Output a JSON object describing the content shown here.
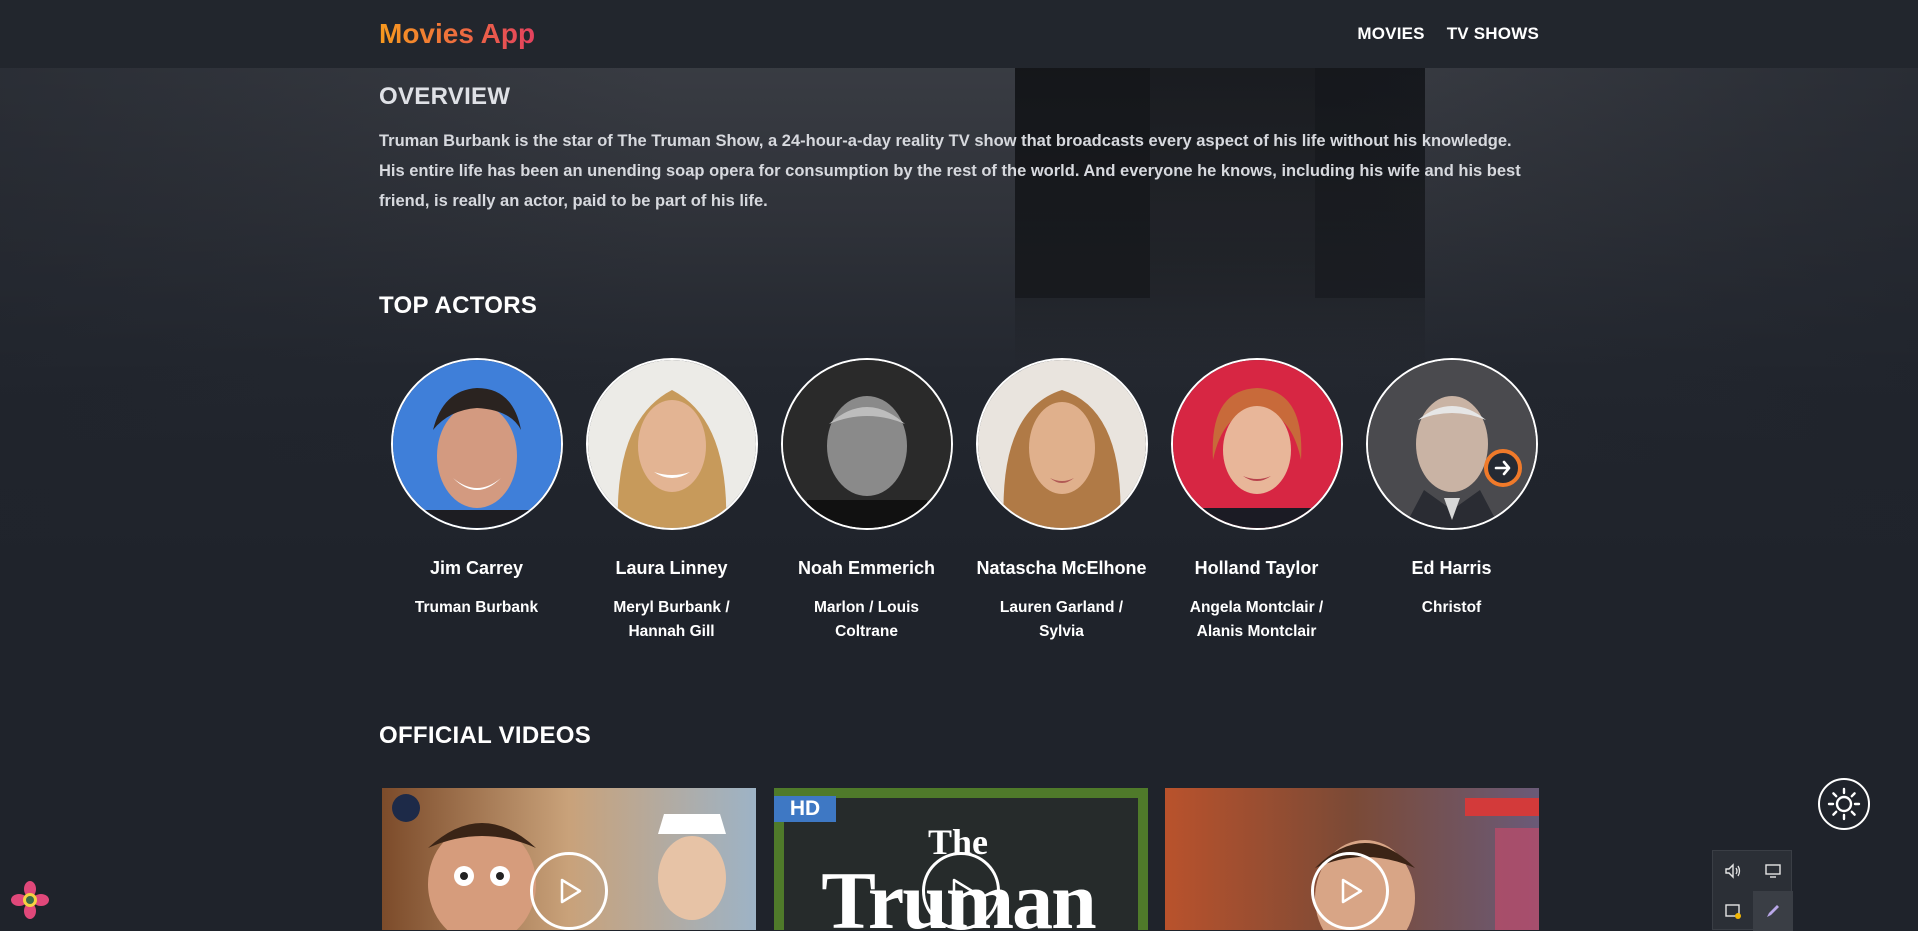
{
  "app": {
    "title": "Movies App"
  },
  "nav": {
    "movies": "MOVIES",
    "tv_shows": "TV SHOWS"
  },
  "overview": {
    "title": "OVERVIEW",
    "text": "Truman Burbank is the star of The Truman Show, a 24-hour-a-day reality TV show that broadcasts every aspect of his life without his knowledge. His entire life has been an unending soap opera for consumption by the rest of the world. And everyone he knows, including his wife and his best friend, is really an actor, paid to be part of his life."
  },
  "actors": {
    "title": "TOP ACTORS",
    "list": [
      {
        "name": "Jim Carrey",
        "role": "Truman Burbank"
      },
      {
        "name": "Laura Linney",
        "role": "Meryl Burbank / Hannah Gill"
      },
      {
        "name": "Noah Emmerich",
        "role": "Marlon / Louis Coltrane"
      },
      {
        "name": "Natascha McElhone",
        "role": "Lauren Garland / Sylvia"
      },
      {
        "name": "Holland Taylor",
        "role": "Angela Montclair / Alanis Montclair"
      },
      {
        "name": "Ed Harris",
        "role": "Christof"
      }
    ]
  },
  "videos": {
    "title": "OFFICIAL VIDEOS",
    "hd_badge": "HD",
    "thumb_text_1": "The",
    "thumb_text_2": "Truman"
  },
  "icons": {
    "next": "arrow-right-circle-icon",
    "theme": "sun-icon",
    "play": "play-icon",
    "tray": [
      "speaker-icon",
      "display-icon",
      "screen-cast-icon",
      "pen-icon"
    ],
    "corner": "flower-icon"
  },
  "colors": {
    "accent_start": "#f89a1e",
    "accent_end": "#e4415e",
    "background": "#1f232b",
    "header": "#22262d",
    "next_ring": "#f07a2a"
  }
}
